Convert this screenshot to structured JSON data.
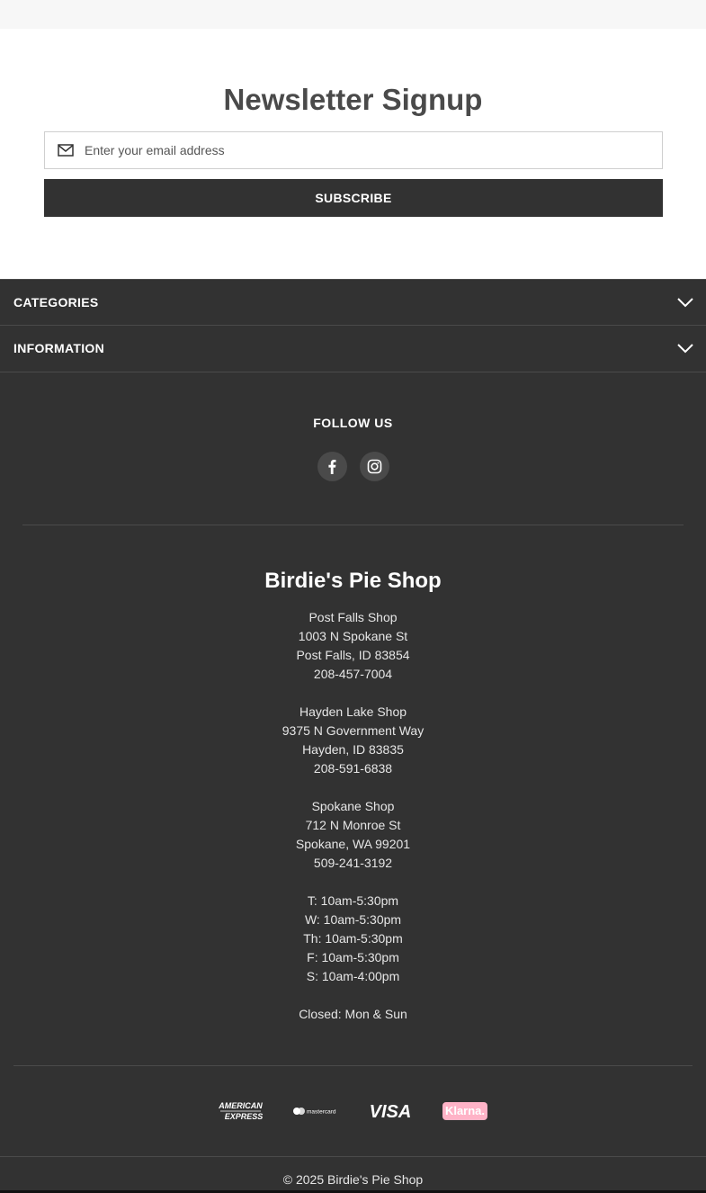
{
  "newsletter": {
    "title": "Newsletter Signup",
    "email_placeholder": "Enter your email address",
    "email_value": "",
    "subscribe_label": "SUBSCRIBE"
  },
  "accordions": [
    {
      "label": "CATEGORIES",
      "icon": "chevron-down-icon"
    },
    {
      "label": "INFORMATION",
      "icon": "chevron-down-icon"
    }
  ],
  "follow": {
    "title": "FOLLOW US",
    "icons": [
      "facebook-icon",
      "instagram-icon"
    ]
  },
  "shop": {
    "name": "Birdie's Pie Shop",
    "lines": [
      "Post Falls Shop",
      "1003 N Spokane St",
      "Post Falls, ID 83854",
      "208-457-7004",
      "",
      "Hayden Lake Shop",
      "9375 N Government Way",
      "Hayden, ID 83835",
      "208-591-6838",
      "",
      "Spokane Shop",
      "712 N Monroe St",
      "Spokane, WA 99201",
      "509-241-3192",
      "",
      "T: 10am-5:30pm",
      "W: 10am-5:30pm",
      "Th: 10am-5:30pm",
      "F: 10am-5:30pm",
      "S: 10am-4:00pm",
      "",
      "Closed: Mon & Sun"
    ]
  },
  "payments": {
    "amex_line1": "AMERICAN",
    "amex_line2": "EXPRESS",
    "mastercard": "mastercard",
    "visa": "VISA",
    "klarna": "Klarna."
  },
  "footer": {
    "copyright": "© 2025 Birdie's Pie Shop"
  },
  "colors": {
    "footer_bg": "#323232",
    "newsletter_bg": "#ffffff",
    "klarna_pink": "#ffb3c7"
  }
}
